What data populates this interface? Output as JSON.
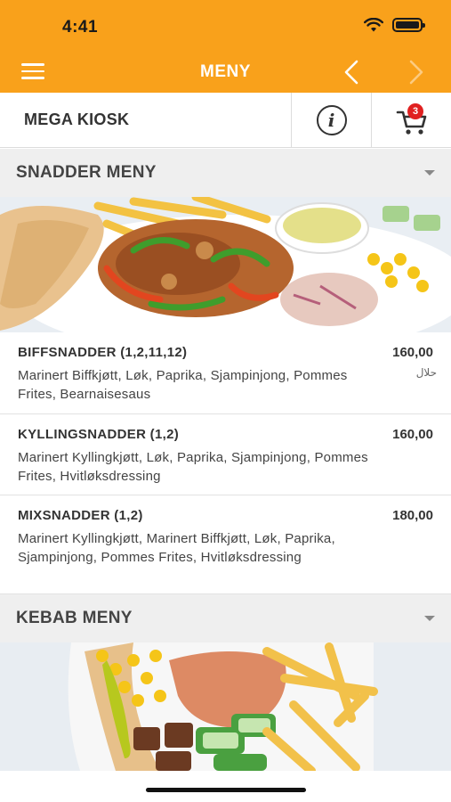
{
  "status": {
    "time": "4:41"
  },
  "nav": {
    "title": "MENY"
  },
  "restaurant": {
    "name": "MEGA KIOSK",
    "cart_count": "3"
  },
  "colors": {
    "accent": "#f9a11b",
    "badge": "#e02020"
  },
  "sections": [
    {
      "title": "SNADDER MENY",
      "items": [
        {
          "name": "BIFFSNADDER (1,2,11,12)",
          "price": "160,00",
          "desc": "Marinert Biffkjøtt, Løk, Paprika, Sjampinjong, Pommes Frites, Bearnaisesaus",
          "badge": "حلال"
        },
        {
          "name": "KYLLINGSNADDER (1,2)",
          "price": "160,00",
          "desc": "Marinert Kyllingkjøtt, Løk, Paprika, Sjampinjong, Pommes Frites, Hvitløksdressing"
        },
        {
          "name": "MIXSNADDER (1,2)",
          "price": "180,00",
          "desc": "Marinert Kyllingkjøtt, Marinert Biffkjøtt, Løk, Paprika, Sjampinjong, Pommes Frites, Hvitløksdressing"
        }
      ]
    },
    {
      "title": "KEBAB MENY"
    }
  ],
  "icons": [
    "hamburger-menu-icon",
    "back-arrow-icon",
    "forward-arrow-icon",
    "info-icon",
    "cart-icon",
    "chevron-down-icon",
    "wifi-icon",
    "battery-icon"
  ]
}
